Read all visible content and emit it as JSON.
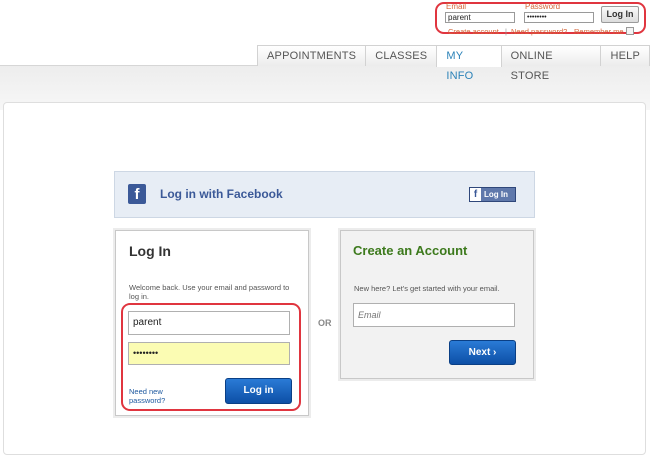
{
  "top_login": {
    "email_label": "Email",
    "email_value": "parent",
    "password_label": "Password",
    "password_value": "••••••••",
    "login_button": "Log In",
    "create_account_link": "Create account",
    "separator": "|",
    "need_password_link": "Need password?",
    "remember_me_label": "Remember me"
  },
  "nav": {
    "tabs": [
      "APPOINTMENTS",
      "CLASSES",
      "MY INFO",
      "ONLINE STORE",
      "HELP"
    ],
    "active_tab": "MY INFO"
  },
  "facebook": {
    "logo_letter": "f",
    "label": "Log in with Facebook",
    "button_icon": "f",
    "button_label": "Log In"
  },
  "login": {
    "title": "Log In",
    "intro": "Welcome back. Use your email and password to log in.",
    "email_value": "parent",
    "password_value": "••••••••",
    "need_password_link": "Need new password?",
    "submit_label": "Log in"
  },
  "divider": "OR",
  "create_account": {
    "title": "Create an Account",
    "intro": "New here? Let's get started with your email.",
    "email_placeholder": "Email",
    "next_label": "Next ›"
  },
  "colors": {
    "highlight": "#e0353f",
    "link_orange": "#d4663a",
    "facebook_blue": "#3b5998",
    "button_blue": "#0d4fa6",
    "create_green": "#3d7a1d",
    "password_fill": "#fbfcb3"
  }
}
